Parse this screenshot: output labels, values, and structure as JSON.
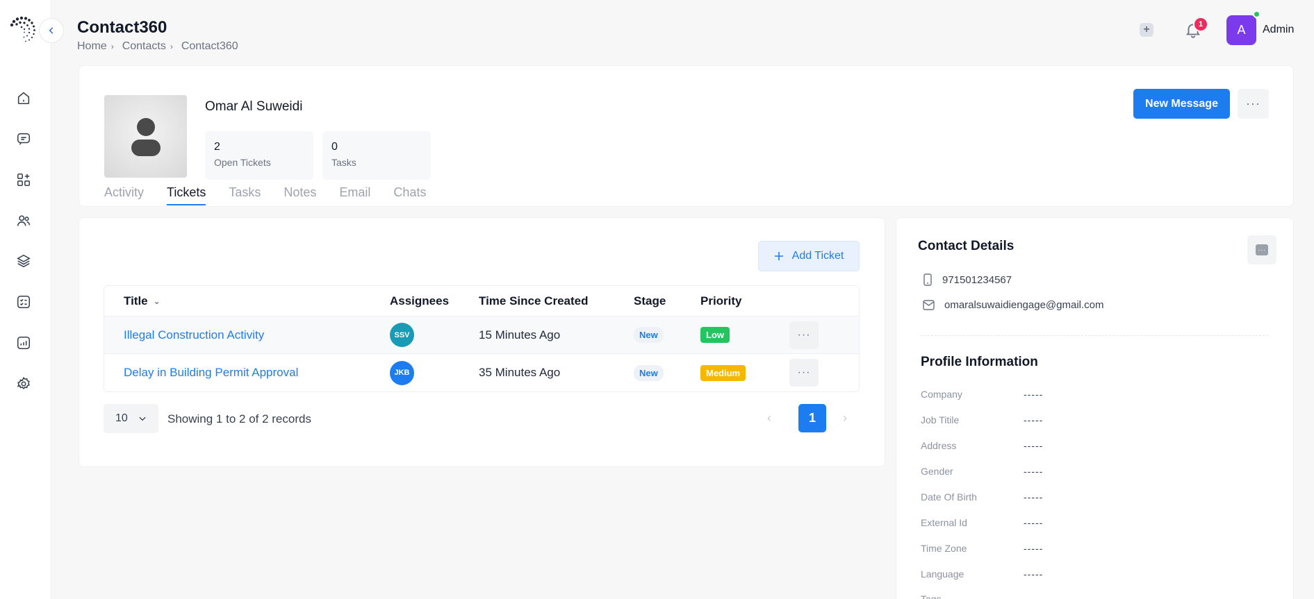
{
  "header": {
    "title": "Contact360",
    "breadcrumb": [
      "Home",
      "Contacts",
      "Contact360"
    ],
    "notification_count": "1",
    "user_initial": "A",
    "user_name": "Admin"
  },
  "sidebar": {
    "items": [
      {
        "name": "home-icon"
      },
      {
        "name": "chat-icon"
      },
      {
        "name": "apps-add-icon"
      },
      {
        "name": "users-icon"
      },
      {
        "name": "layers-icon"
      },
      {
        "name": "checklist-icon"
      },
      {
        "name": "analytics-icon"
      },
      {
        "name": "settings-icon"
      }
    ]
  },
  "profile": {
    "name": "Omar Al Suweidi",
    "stats": [
      {
        "value": "2",
        "label": "Open Tickets"
      },
      {
        "value": "0",
        "label": "Tasks"
      }
    ],
    "new_message_label": "New Message",
    "more_label": "···",
    "tabs": [
      "Activity",
      "Tickets",
      "Tasks",
      "Notes",
      "Email",
      "Chats"
    ],
    "active_tab": "Tickets"
  },
  "tickets": {
    "add_label": "Add Ticket",
    "columns": [
      "Title",
      "Assignees",
      "Time Since Created",
      "Stage",
      "Priority"
    ],
    "rows": [
      {
        "title": "Illegal Construction Activity",
        "assignee": "SSV",
        "assignee_color": "#1a9bb5",
        "time": "15 Minutes Ago",
        "stage": "New",
        "priority": "Low",
        "priority_color": "#22c55e",
        "more": "···"
      },
      {
        "title": "Delay in Building Permit Approval",
        "assignee": "JKB",
        "assignee_color": "#1d7df0",
        "time": "35 Minutes Ago",
        "stage": "New",
        "priority": "Medium",
        "priority_color": "#f5b800",
        "more": "···"
      }
    ],
    "page_size": "10",
    "showing": "Showing 1 to 2 of 2 records",
    "current_page": "1"
  },
  "contact_details": {
    "title": "Contact Details",
    "more_label": "···",
    "phone": "971501234567",
    "email": "omaralsuwaidiengage@gmail.com",
    "profile_info_title": "Profile Information",
    "fields": [
      {
        "label": "Company",
        "value": "-----"
      },
      {
        "label": "Job Titile",
        "value": "-----"
      },
      {
        "label": "Address",
        "value": "-----"
      },
      {
        "label": "Gender",
        "value": "-----"
      },
      {
        "label": "Date Of Birth",
        "value": "-----"
      },
      {
        "label": "External Id",
        "value": "-----"
      },
      {
        "label": "Time Zone",
        "value": "-----"
      },
      {
        "label": "Language",
        "value": "-----"
      },
      {
        "label": "Tags",
        "value": ""
      }
    ]
  },
  "colors": {
    "accent": "#1d7df0",
    "avatar": "#7c3aed",
    "badge": "#ef2b5c",
    "online": "#22c55e"
  }
}
